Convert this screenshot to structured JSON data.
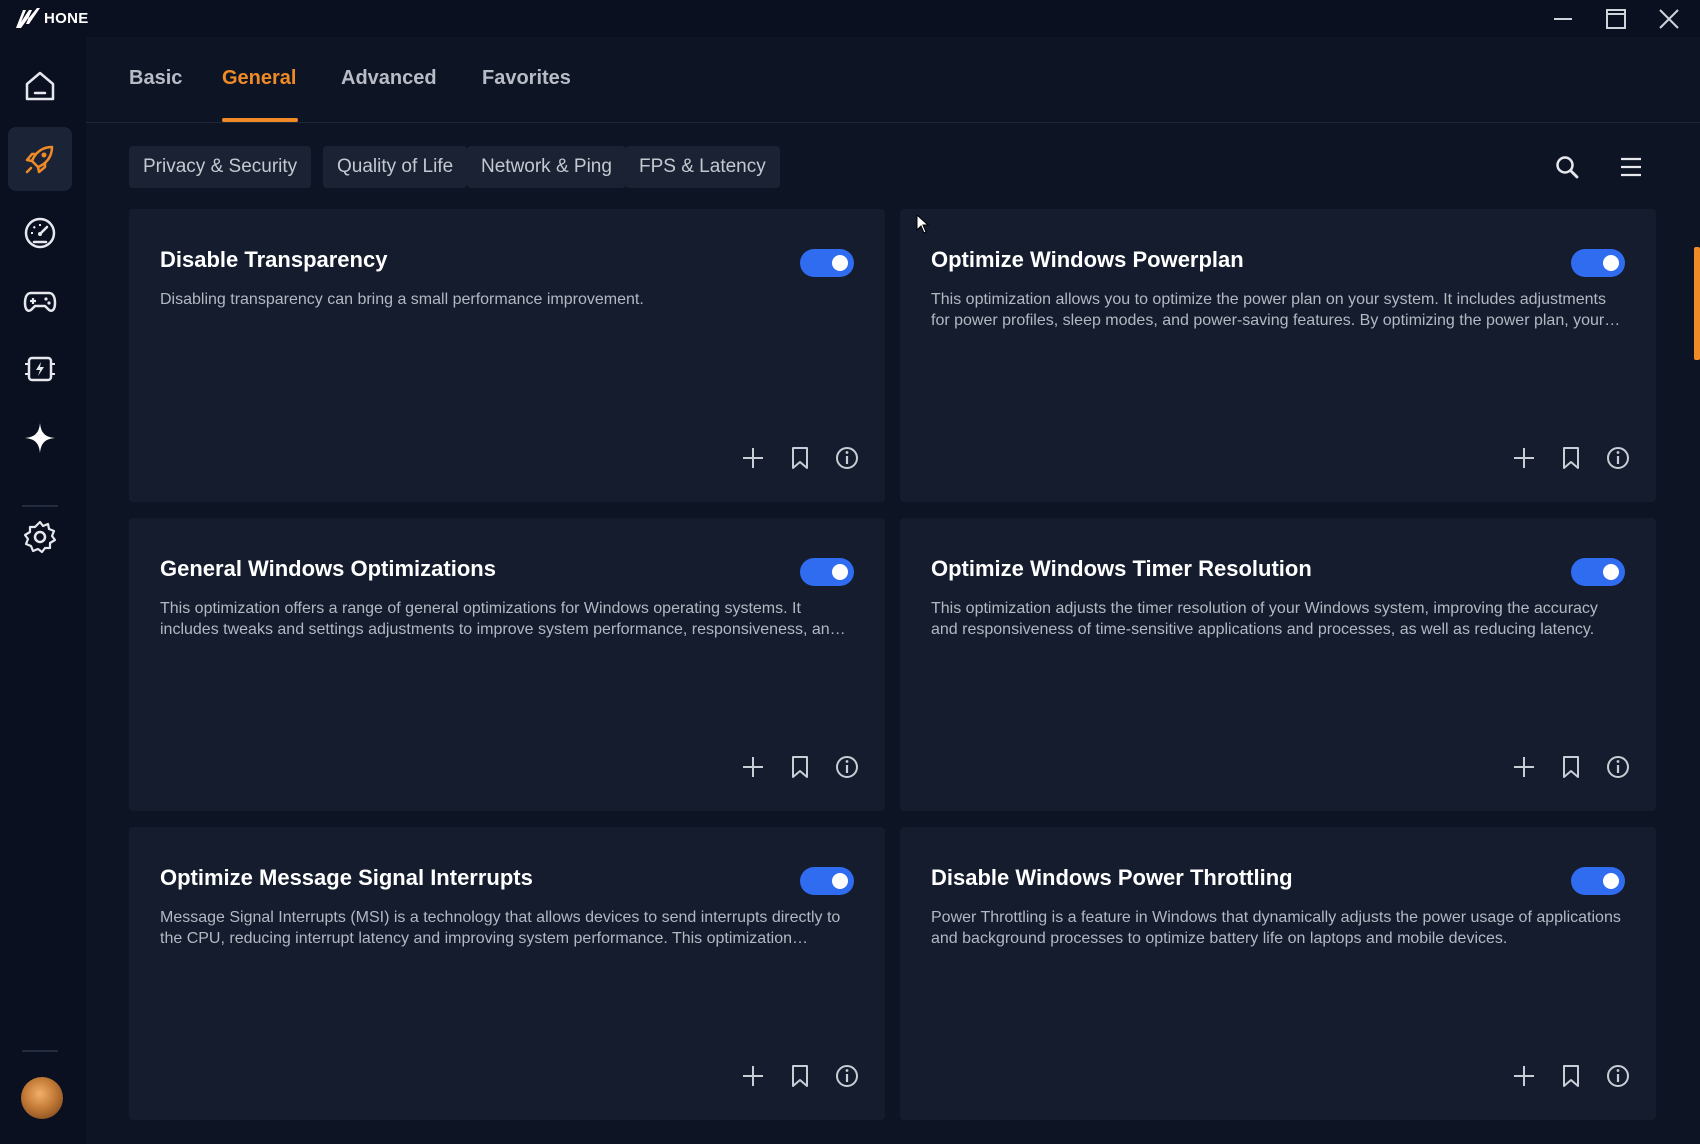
{
  "app": {
    "name": "HONE"
  },
  "colors": {
    "accent": "#f08a26",
    "toggle_on": "#2f6cf0",
    "background": "#0d1424",
    "card": "#141c2d"
  },
  "window_controls": [
    "minimize-icon",
    "maximize-icon",
    "close-icon"
  ],
  "sidebar": {
    "items": [
      {
        "name": "home",
        "icon": "home-icon",
        "active": false
      },
      {
        "name": "optimizations",
        "icon": "rocket-icon",
        "active": true
      },
      {
        "name": "performance",
        "icon": "speedometer-icon",
        "active": false
      },
      {
        "name": "games",
        "icon": "gamepad-icon",
        "active": false
      },
      {
        "name": "hardware",
        "icon": "chip-icon",
        "active": false
      },
      {
        "name": "ai",
        "icon": "sparkle-icon",
        "active": false
      },
      {
        "name": "settings",
        "icon": "gear-icon",
        "active": false
      }
    ],
    "avatar": "user-avatar"
  },
  "tabs": [
    {
      "label": "Basic",
      "active": false
    },
    {
      "label": "General",
      "active": true
    },
    {
      "label": "Advanced",
      "active": false
    },
    {
      "label": "Favorites",
      "active": false
    }
  ],
  "filters": [
    "Privacy & Security",
    "Quality of Life",
    "Network & Ping",
    "FPS & Latency"
  ],
  "toolbar": {
    "search_icon": "search-icon",
    "menu_icon": "menu-icon"
  },
  "cards": [
    {
      "title": "Disable Transparency",
      "description": "Disabling transparency can bring a small performance improvement.",
      "enabled": true
    },
    {
      "title": "Optimize Windows Powerplan",
      "description": "This optimization allows you to optimize the power plan on your system. It includes adjustments for power profiles, sleep modes, and power-saving features. By optimizing the power plan, your system can achieve better performance.",
      "enabled": true
    },
    {
      "title": "General Windows Optimizations",
      "description": "This optimization offers a range of general optimizations for Windows operating systems. It includes tweaks and settings adjustments to improve system performance, responsiveness, and stability.",
      "enabled": true
    },
    {
      "title": "Optimize Windows Timer Resolution",
      "description": "This optimization adjusts the timer resolution of your Windows system, improving the accuracy and responsiveness of time-sensitive applications and processes, as well as reducing latency.",
      "enabled": true
    },
    {
      "title": "Optimize Message Signal Interrupts",
      "description": "Message Signal Interrupts (MSI) is a technology that allows devices to send interrupts directly to the CPU, reducing interrupt latency and improving system performance. This optimization enables MSI mode.",
      "enabled": true
    },
    {
      "title": "Disable Windows Power Throttling",
      "description": "Power Throttling is a feature in Windows that dynamically adjusts the power usage of applications and background processes to optimize battery life on laptops and mobile devices.",
      "enabled": true
    }
  ],
  "card_actions": [
    "plus-icon",
    "bookmark-icon",
    "info-icon"
  ]
}
